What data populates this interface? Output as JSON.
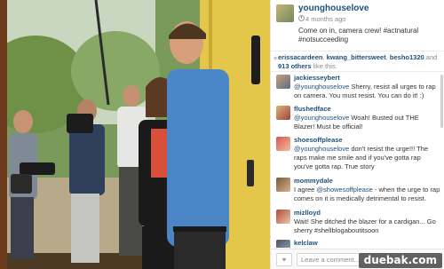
{
  "post": {
    "username": "younghouselove",
    "time": "4 months ago",
    "caption": "Come on in, camera crew! #actnatural #notsucceeding"
  },
  "likes": {
    "likers": [
      "erissacardeen",
      "kwang_bittersweet",
      "besho1320"
    ],
    "count_text": "913 others",
    "suffix": "like this."
  },
  "comments": [
    {
      "user": "jackiesseybert",
      "mention": "@younghouselove",
      "text": " Sherry, resist all urges to rap on camera. You must resist. You can do it! :)"
    },
    {
      "user": "flushedface",
      "mention": "@younghouselove",
      "text": " Woah! Busted out THE Blazer! Must be official!"
    },
    {
      "user": "shoesoffplease",
      "mention": "@younghouselove",
      "text": " don't resist the urge!!! The raps make me smile and if you've gotta rap you've gotta rap. True story"
    },
    {
      "user": "mommydale",
      "prefix": "I agree ",
      "mention": "@showesoffplease",
      "text": " - when the urge to rap comes on it is medically detrimental to resist."
    },
    {
      "user": "mizlloyd",
      "prefix": "",
      "mention": "",
      "text": "Wait! She ditched the blazer for a cardigan... Go sherry #shellblogaboutitsoon"
    },
    {
      "user": "kelclaw",
      "prefix": "",
      "mention": "",
      "text": ""
    }
  ],
  "footer": {
    "like_icon": "heart-icon",
    "comment_placeholder": "Leave a comment..."
  },
  "watermark": "duebak.com",
  "colors": {
    "link": "#1f4f7a",
    "door": "#e3c64a"
  }
}
